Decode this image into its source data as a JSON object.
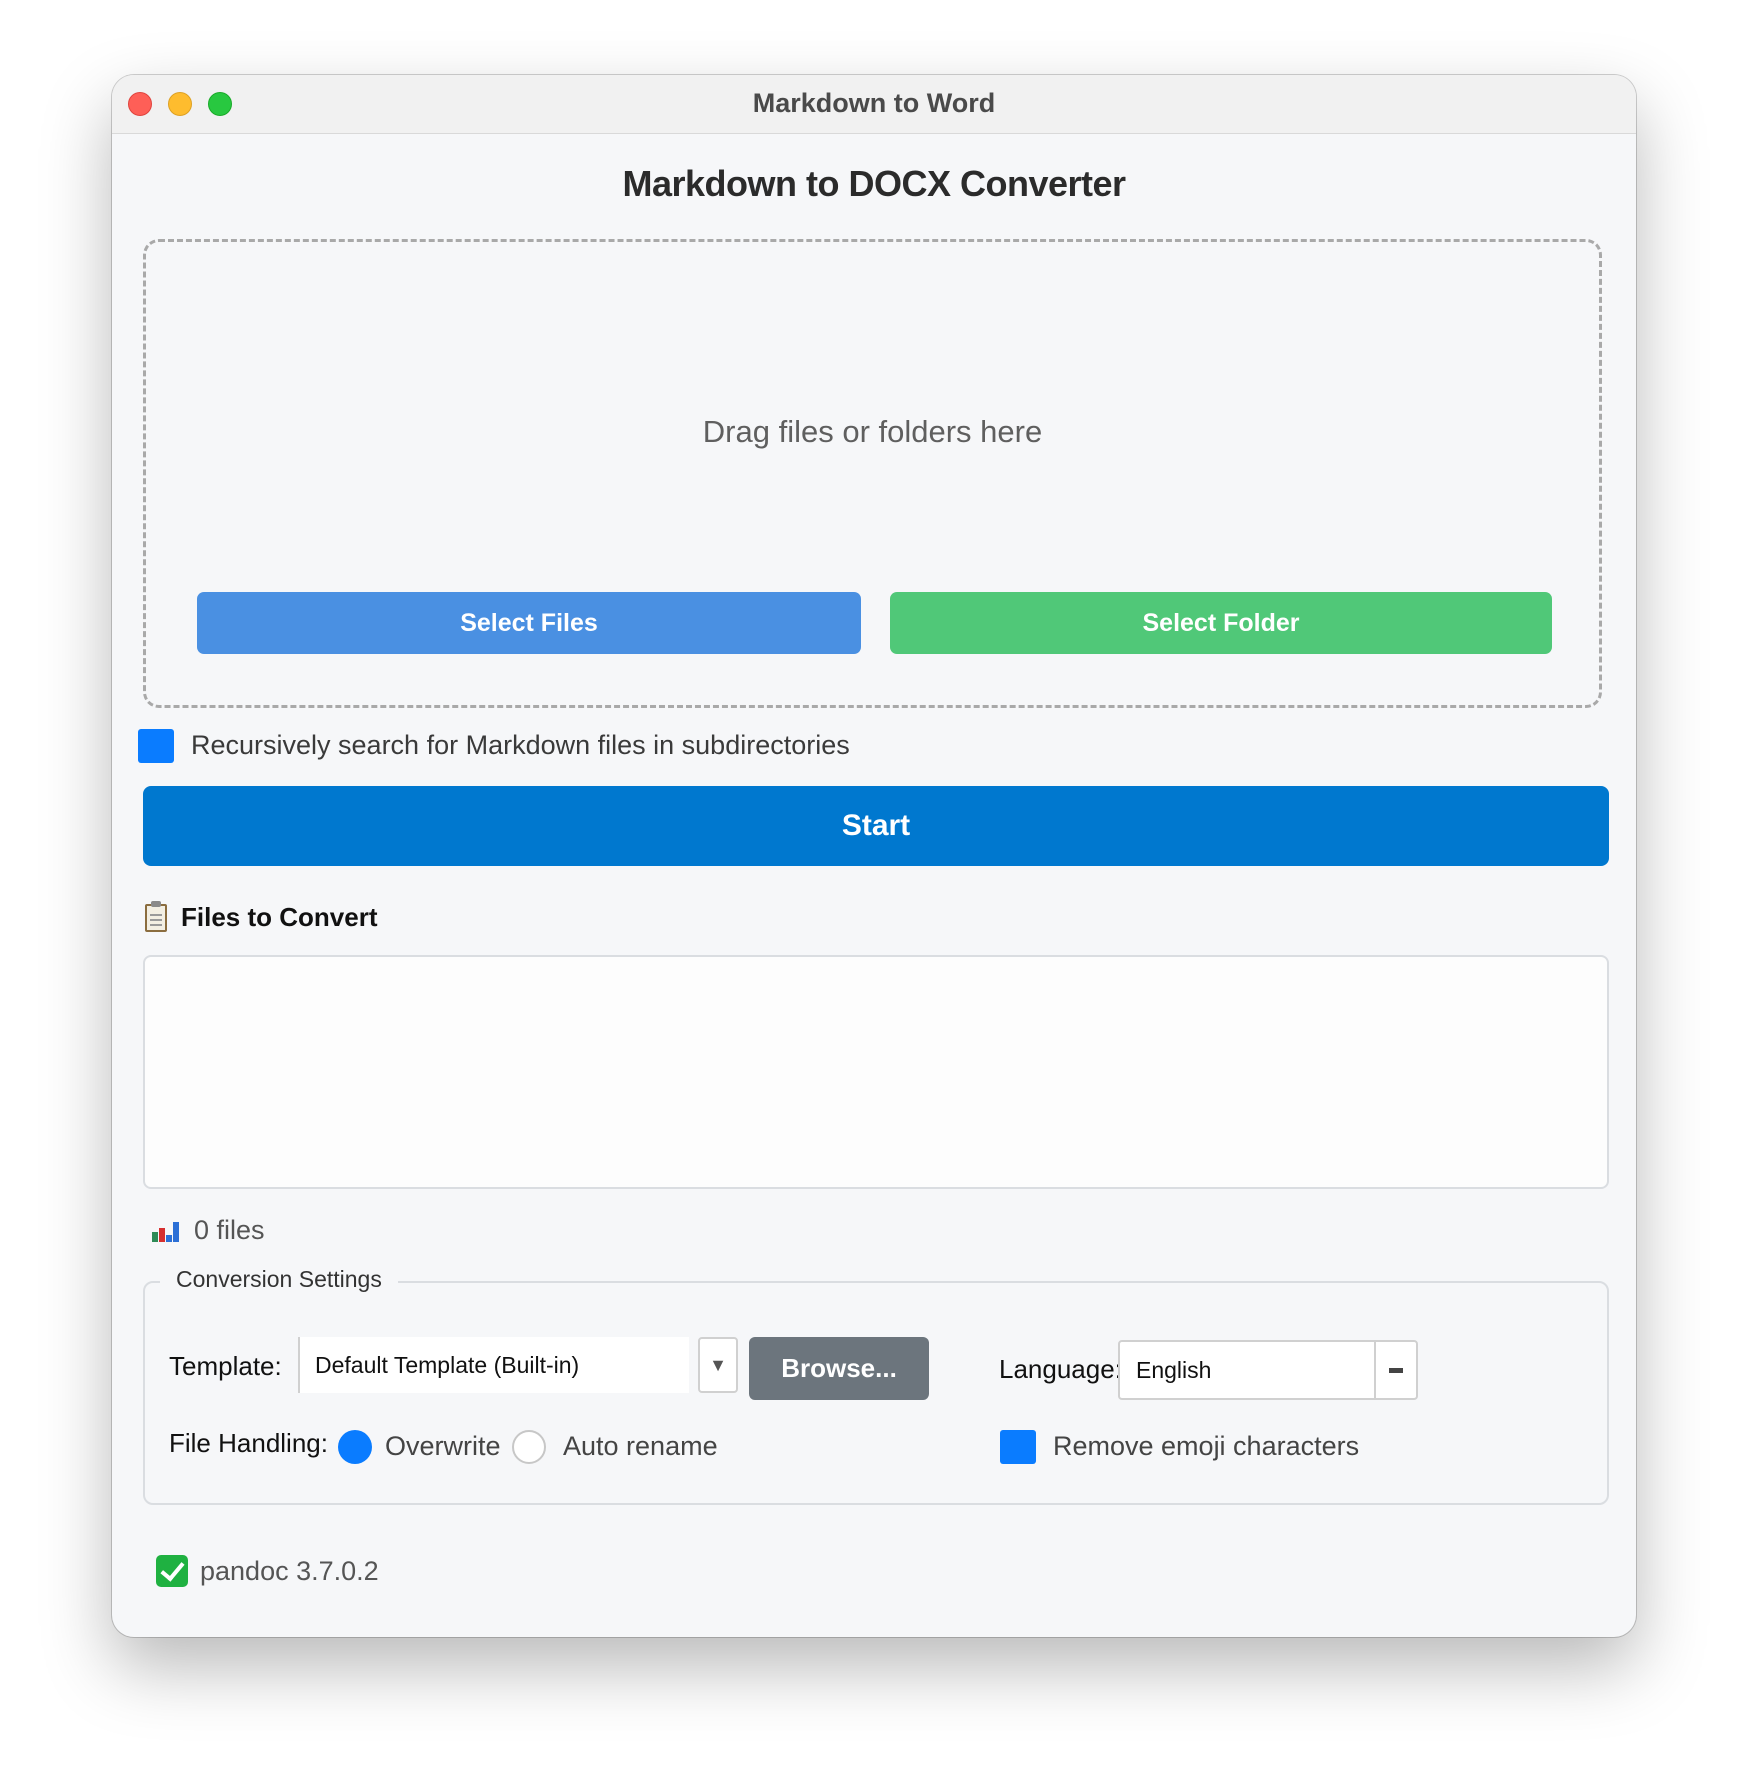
{
  "window": {
    "title": "Markdown to Word"
  },
  "app": {
    "title": "Markdown to DOCX Converter"
  },
  "dropzone": {
    "prompt": "Drag files or folders here",
    "select_files_label": "Select Files",
    "select_folder_label": "Select Folder"
  },
  "options": {
    "recursive_label": "Recursively search for Markdown files in subdirectories",
    "recursive_checked": true
  },
  "actions": {
    "start_label": "Start"
  },
  "file_list": {
    "title": "Files to Convert",
    "files": [],
    "count_label": "0 files"
  },
  "settings": {
    "legend": "Conversion Settings",
    "template_label": "Template:",
    "template_value": "Default Template (Built-in)",
    "browse_label": "Browse...",
    "language_label": "Language:",
    "language_value": "English",
    "file_handling_label": "File Handling:",
    "file_handling_options": [
      {
        "label": "Overwrite",
        "selected": true
      },
      {
        "label": "Auto rename",
        "selected": false
      }
    ],
    "remove_emoji_label": "Remove emoji characters",
    "remove_emoji_checked": true
  },
  "status": {
    "pandoc_label": "pandoc 3.7.0.2"
  },
  "colors": {
    "select_files": "#4a90e2",
    "select_folder": "#50c878",
    "start": "#0078cf",
    "browse": "#6c757d",
    "accent": "#0a7cff"
  },
  "icons": {
    "files_header": "clipboard-icon",
    "count": "bar-chart-icon",
    "status": "check-mark-icon"
  }
}
